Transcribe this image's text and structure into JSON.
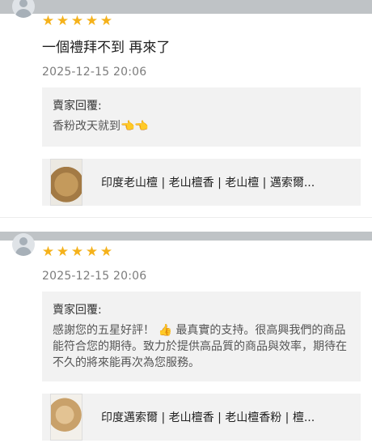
{
  "reviews": [
    {
      "rating": 5,
      "comment": "一個禮拜不到 再來了",
      "date": "2025-12-15 20:06",
      "reply_title": "賣家回覆:",
      "reply_text": "香粉改天就到👈👈",
      "product_title": "印度老山檀 | 老山檀香 | 老山檀 | 邁索爾..."
    },
    {
      "rating": 5,
      "date": "2025-12-15 20:06",
      "reply_title": "賣家回覆:",
      "reply_text": "感謝您的五星好評！ 👍 最真實的支持。很高興我們的商品能符合您的期待。致力於提供高品質的商品與效率，期待在不久的將來能再次為您服務。",
      "product_title": "印度邁索爾 | 老山檀香 | 老山檀香粉 | 檀..."
    }
  ],
  "icons": {
    "star": "star-icon",
    "avatar": "user-avatar-icon"
  },
  "colors": {
    "star": "#f5b21b",
    "reply_bg": "#f2f2f2"
  }
}
